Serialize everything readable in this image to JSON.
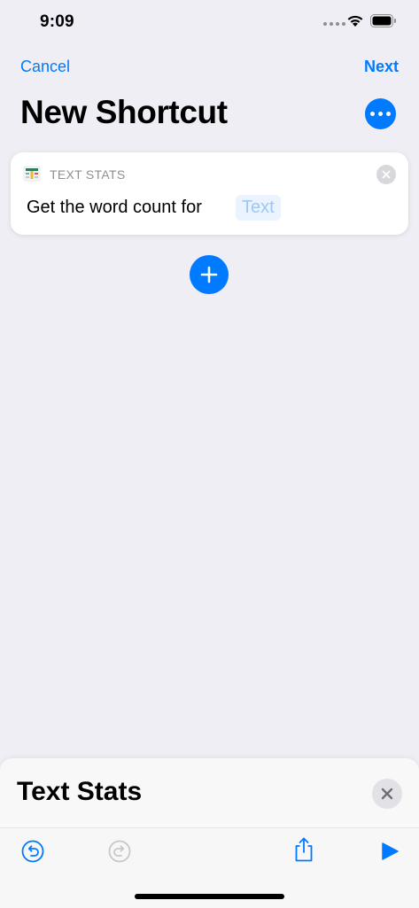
{
  "status_bar": {
    "time": "9:09"
  },
  "nav": {
    "cancel_label": "Cancel",
    "next_label": "Next",
    "title": "New Shortcut"
  },
  "action_card": {
    "app_name": "TEXT STATS",
    "sentence": "Get the word count for",
    "parameter_placeholder": "Text"
  },
  "bottom_sheet": {
    "title": "Text Stats"
  },
  "icons": {
    "more": "ellipsis-icon",
    "add": "plus-icon",
    "undo": "undo-icon",
    "redo": "redo-icon",
    "share": "share-icon",
    "play": "play-icon",
    "close": "close-icon"
  },
  "colors": {
    "accent": "#007AFF",
    "background": "#EFEEF4",
    "card": "#FFFFFF",
    "param_text": "#9CC8F5",
    "disabled": "#C7C7CC"
  }
}
